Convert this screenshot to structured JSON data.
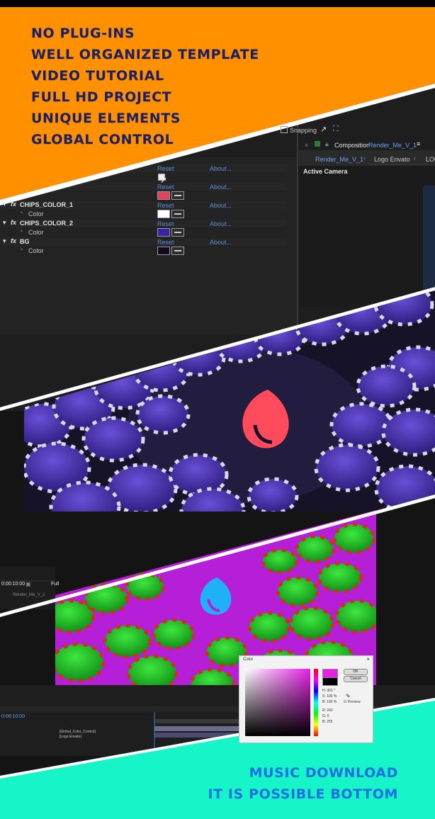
{
  "features": [
    "NO PLUG-INS",
    "WELL ORGANIZED TEMPLATE",
    "VIDEO TUTORIAL",
    "FULL HD PROJECT",
    "UNIQUE ELEMENTS",
    "GLOBAL CONTROL"
  ],
  "bottom_lines": [
    "MUSIC DOWNLOAD",
    "IT IS POSSIBLE BOTTOM"
  ],
  "colors": {
    "orange": "#ff9000",
    "teal": "#16f5c8",
    "navy_text": "#1b1f6a",
    "blue_text": "#1e6fe0",
    "chip_purple": "#4a2fae",
    "logo_red": "#ff4b5c",
    "logo_cyan": "#1fb0f5",
    "magenta_bg": "#b61fd8",
    "chip_green": "#1ec21e"
  },
  "toolbar": {
    "snapping": "Snapping"
  },
  "composition": {
    "header": "Composition",
    "name": "Render_Me_V_1",
    "tabs": [
      "Render_Me_V_1",
      "Logo Envato",
      "LOG"
    ],
    "active_camera": "Active Camera"
  },
  "effects": {
    "reset": "Reset",
    "about": "About...",
    "groups": [
      {
        "name": "CHIPS_COLOR_1",
        "prop": "Color"
      },
      {
        "name": "CHIPS_COLOR_2",
        "prop": "Color"
      },
      {
        "name": "BG",
        "prop": "Color"
      }
    ]
  },
  "timeline": {
    "time": "0:00:10:00",
    "quality": "Full",
    "comp": "Render_Me_V_2",
    "layers": [
      "[Global_Color_Control]",
      "[Logo Envato]"
    ]
  },
  "color_picker": {
    "title": "Color",
    "ok": "OK",
    "cancel": "Cancel",
    "preview": "Preview",
    "fields": [
      "H: 301 °",
      "S: 100 %",
      "B: 100 %",
      "R: 242",
      "G: 0",
      "B: 255"
    ]
  }
}
